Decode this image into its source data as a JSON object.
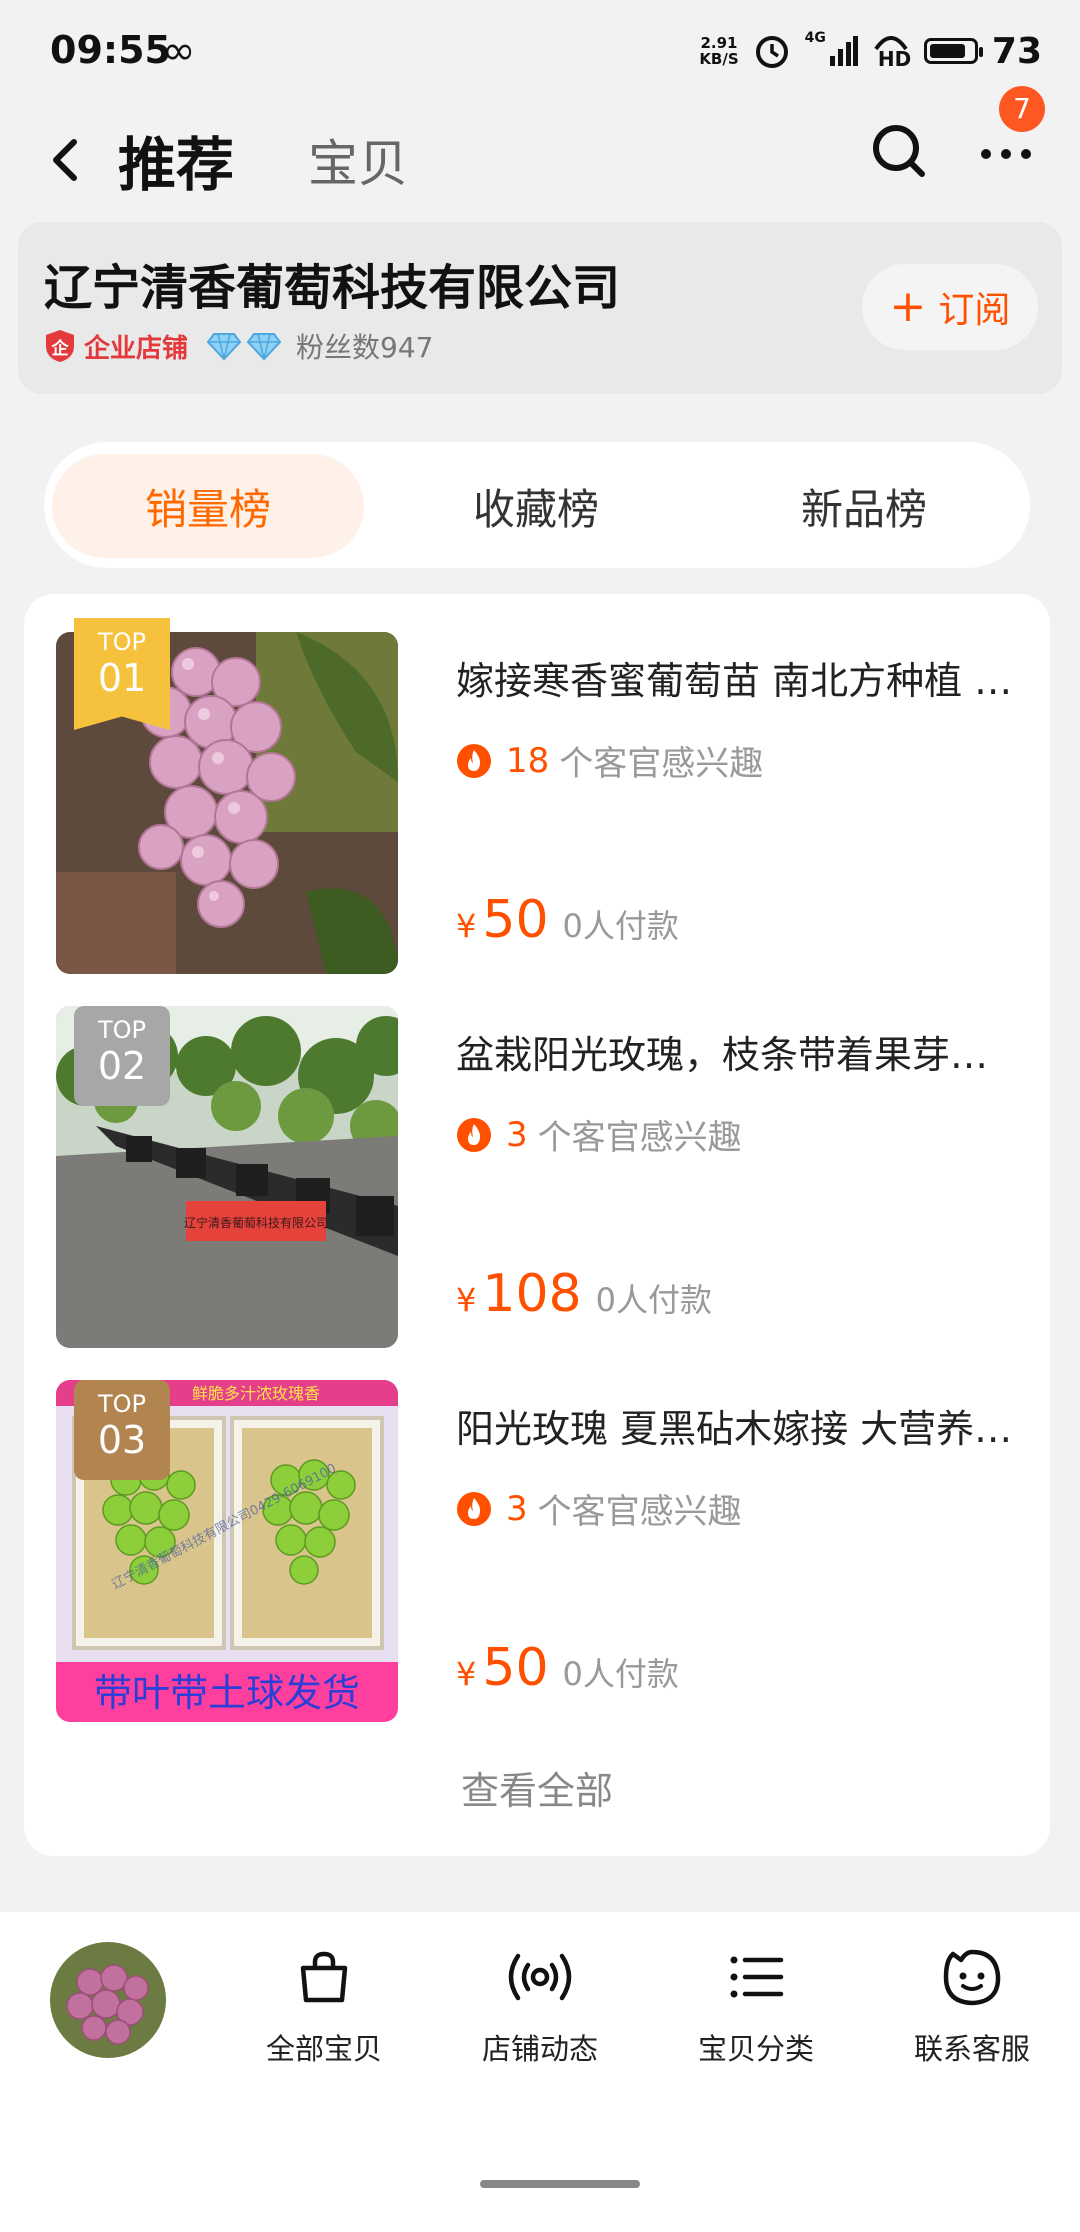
{
  "status_bar": {
    "time": "09:55",
    "infinity": "∞",
    "net_speed_top": "2.91",
    "net_speed_bottom": "KB/S",
    "network": "4G",
    "hd": "HD",
    "battery_level": "73"
  },
  "nav": {
    "tab_recommend": "推荐",
    "tab_items": "宝贝",
    "badge_count": "7"
  },
  "store": {
    "name": "辽宁清香葡萄科技有限公司",
    "shield_text": "企",
    "type_label": "企业店铺",
    "fans": "粉丝数947",
    "subscribe_plus": "+",
    "subscribe_label": "订阅"
  },
  "rank_tabs": {
    "sales": "销量榜",
    "favorites": "收藏榜",
    "new": "新品榜",
    "active": "sales"
  },
  "products": [
    {
      "top_word": "TOP",
      "rank": "01",
      "title": "嫁接寒香蜜葡萄苗 南北方种植 果树苗 盆栽地栽",
      "interest_count": "18",
      "interest_label": "个客官感兴趣",
      "currency": "¥",
      "price": "50",
      "paid": "0人付款"
    },
    {
      "top_word": "TOP",
      "rank": "02",
      "title": "盆栽阳光玫瑰，枝条带着果芽，当年结果",
      "interest_count": "3",
      "interest_label": "个客官感兴趣",
      "currency": "¥",
      "price": "108",
      "paid": "0人付款",
      "image_sign_text": "辽宁清香葡萄科技有限公司"
    },
    {
      "top_word": "TOP",
      "rank": "03",
      "title": "阳光玫瑰 夏黑砧木嫁接 大营养钵苗",
      "interest_count": "3",
      "interest_label": "个客官感兴趣",
      "currency": "¥",
      "price": "50",
      "paid": "0人付款",
      "image_banner_top": "鲜脆多汁浓玫瑰香",
      "image_banner_bottom": "带叶带土球发货",
      "image_watermark": "辽宁清香葡萄科技有限公司0429-6069100"
    }
  ],
  "view_all": "查看全部",
  "bottom_nav": {
    "all_items": "全部宝贝",
    "store_news": "店铺动态",
    "categories": "宝贝分类",
    "customer_service": "联系客服"
  },
  "colors": {
    "accent": "#ff5000",
    "tab_active_bg": "#fff0e8",
    "gold": "#f6c23d",
    "silver": "#a7a7a7",
    "bronze": "#b2844f"
  }
}
